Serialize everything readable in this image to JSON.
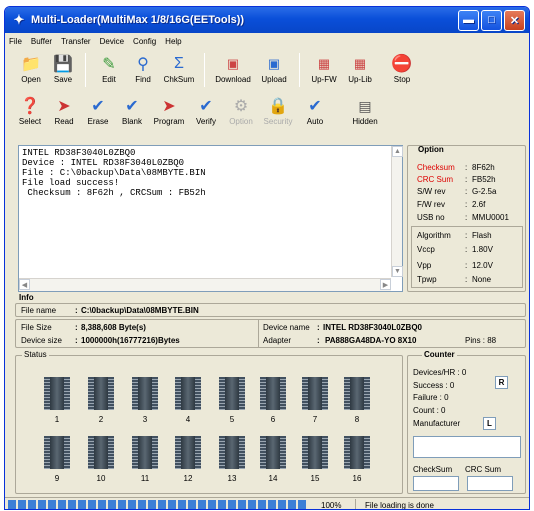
{
  "window": {
    "title": "Multi-Loader(MultiMax 1/8/16G(EETools))"
  },
  "menu": [
    "File",
    "Buffer",
    "Transfer",
    "Device",
    "Config",
    "Help"
  ],
  "toolbar1": [
    {
      "label": "Open",
      "icon": "folder-icon"
    },
    {
      "label": "Save",
      "icon": "disk-icon"
    },
    {
      "label": "Edit",
      "icon": "edit-icon"
    },
    {
      "label": "Find",
      "icon": "find-icon"
    },
    {
      "label": "ChkSum",
      "icon": "sigma-icon"
    },
    {
      "label": "Download",
      "icon": "download-icon"
    },
    {
      "label": "Upload",
      "icon": "upload-icon"
    },
    {
      "label": "Up-FW",
      "icon": "upfw-icon"
    },
    {
      "label": "Up-Lib",
      "icon": "uplib-icon"
    },
    {
      "label": "Stop",
      "icon": "stop-icon"
    }
  ],
  "toolbar2": [
    {
      "label": "Select",
      "icon": "select-icon",
      "enabled": true
    },
    {
      "label": "Read",
      "icon": "read-icon",
      "enabled": true
    },
    {
      "label": "Erase",
      "icon": "erase-icon",
      "enabled": true
    },
    {
      "label": "Blank",
      "icon": "blank-icon",
      "enabled": true
    },
    {
      "label": "Program",
      "icon": "program-icon",
      "enabled": true
    },
    {
      "label": "Verify",
      "icon": "verify-icon",
      "enabled": true
    },
    {
      "label": "Option",
      "icon": "option-icon",
      "enabled": false
    },
    {
      "label": "Security",
      "icon": "security-icon",
      "enabled": false
    },
    {
      "label": "Auto",
      "icon": "auto-icon",
      "enabled": true
    },
    {
      "label": "Hidden",
      "icon": "hidden-icon",
      "enabled": true
    }
  ],
  "log": "INTEL RD38F3040L0ZBQ0\nDevice : INTEL RD38F3040L0ZBQ0\nFile : C:\\0backup\\Data\\08MBYTE.BIN\nFile load success!\n Checksum : 8F62h , CRCSum : FB52h",
  "option": {
    "title": "Option",
    "checksum_label": "Checksum",
    "checksum": "8F62h",
    "crc_label": "CRC Sum",
    "crc": "FB52h",
    "sw_label": "S/W rev",
    "sw": "G-2.5a",
    "fw_label": "F/W rev",
    "fw": "2.6f",
    "usb_label": "USB no",
    "usb": "MMU0001",
    "algo_label": "Algorithm",
    "algo": "Flash",
    "vccp_label": "Vccp",
    "vccp": "1.80V",
    "vpp_label": "Vpp",
    "vpp": "12.0V",
    "tpwp_label": "Tpwp",
    "tpwp": "None"
  },
  "info": {
    "title": "Info",
    "filename_label": "File name",
    "filename": "C:\\0backup\\Data\\08MBYTE.BIN",
    "filesize_label": "File Size",
    "filesize": "8,388,608 Byte(s)",
    "devsize_label": "Device size",
    "devsize": "1000000h(16777216)Bytes",
    "devname_label": "Device name",
    "devname": "INTEL RD38F3040L0ZBQ0",
    "adapter_label": "Adapter",
    "adapter": "PA888GA48DA-YO 8X10",
    "pins": "Pins : 88"
  },
  "status": {
    "title": "Status",
    "sites": [
      "1",
      "2",
      "3",
      "4",
      "5",
      "6",
      "7",
      "8",
      "9",
      "10",
      "11",
      "12",
      "13",
      "14",
      "15",
      "16"
    ]
  },
  "counter": {
    "title": "Counter",
    "devices_hr": "Devices/HR : 0",
    "success": "Success : 0",
    "failure": "Failure : 0",
    "count": "Count : 0",
    "r_label": "R",
    "manufacturer_label": "Manufacturer",
    "l_label": "L",
    "checksum_label": "CheckSum",
    "crcsum_label": "CRC Sum"
  },
  "statusbar": {
    "progress_percent": 100,
    "progress_text": "100%",
    "message": "File loading is done"
  }
}
